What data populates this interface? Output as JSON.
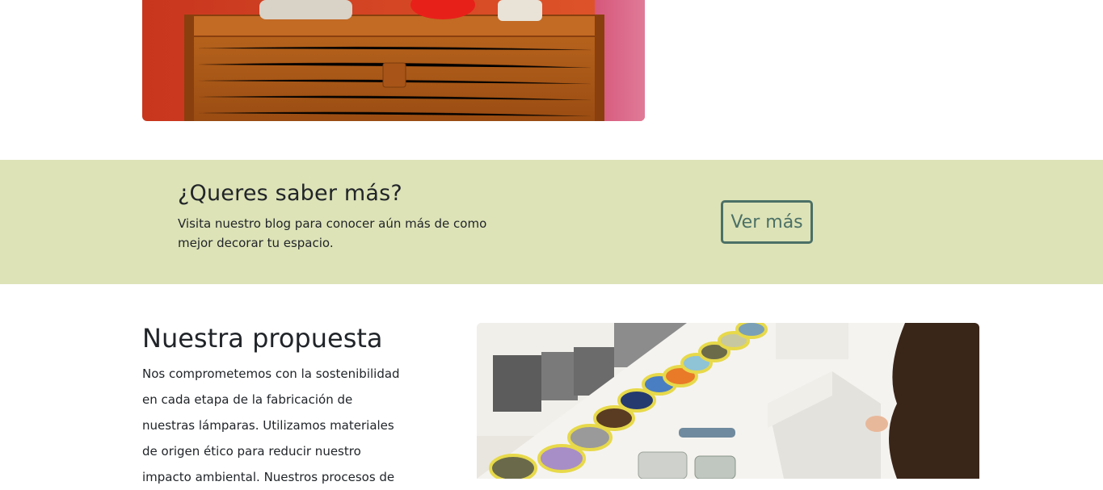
{
  "top_image": {
    "alt": "furniture-photo"
  },
  "cta": {
    "title": "¿Queres saber más?",
    "text": "Visita nuestro blog para conocer aún más de como mejor decorar tu espacio.",
    "button_label": "Ver más"
  },
  "proposal": {
    "title": "Nuestra propuesta",
    "text": "Nos comprometemos con la sostenibilidad en cada etapa de la fabricación de nuestras lámparas. Utilizamos materiales de origen ético para reducir nuestro impacto ambiental. Nuestros procesos de"
  },
  "colors": {
    "band_background": "#dde3b7",
    "button_accent": "#4b7066",
    "text": "#212529"
  }
}
